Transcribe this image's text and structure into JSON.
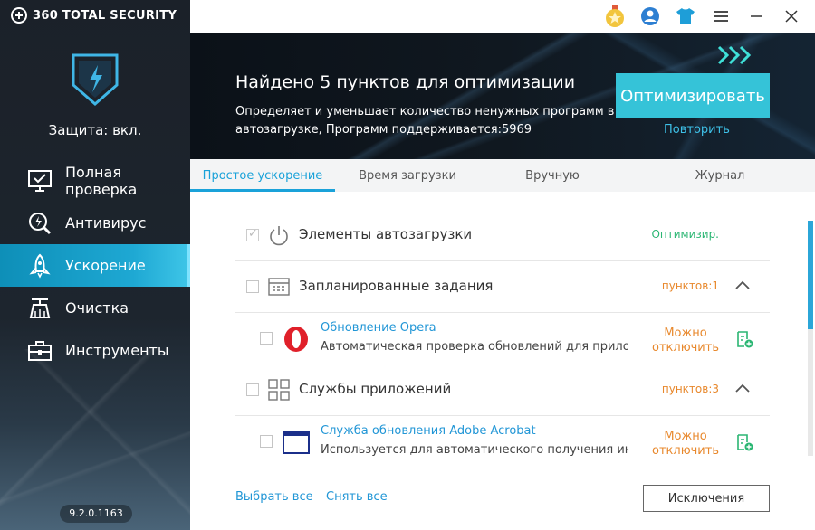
{
  "app": {
    "brand": "360 TOTAL SECURITY",
    "version": "9.2.0.1163"
  },
  "sidebar": {
    "protection": "Защита: вкл.",
    "items": [
      {
        "label": "Полная проверка",
        "icon": "monitor-check-icon",
        "active": false
      },
      {
        "label": "Антивирус",
        "icon": "magnifier-bolt-icon",
        "active": false
      },
      {
        "label": "Ускорение",
        "icon": "rocket-icon",
        "active": true
      },
      {
        "label": "Очистка",
        "icon": "broom-icon",
        "active": false
      },
      {
        "label": "Инструменты",
        "icon": "toolbox-icon",
        "active": false
      }
    ]
  },
  "topbar": {
    "icons": [
      "medal-icon",
      "user-icon",
      "shirt-icon",
      "menu-icon",
      "minimize-icon",
      "close-icon"
    ]
  },
  "header": {
    "title": "Найдено 5 пунктов для оптимизации",
    "description": "Определяет и уменьшает количество ненужных программ в автозагрузке, Программ поддерживается:5969",
    "optimize_button": "Оптимизировать",
    "repeat_link": "Повторить"
  },
  "tabs": [
    {
      "label": "Простое ускорение",
      "active": true
    },
    {
      "label": "Время загрузки",
      "active": false
    },
    {
      "label": "Вручную",
      "active": false
    },
    {
      "label": "Журнал",
      "active": false
    }
  ],
  "groups": {
    "startup": {
      "label": "Элементы автозагрузки",
      "status": "Оптимизир.",
      "status_color": "#2bb673"
    },
    "scheduled": {
      "label": "Запланированные задания",
      "status": "пунктов:1",
      "status_color": "#e8882c"
    },
    "services": {
      "label": "Службы приложений",
      "status": "пунктов:3",
      "status_color": "#e8882c"
    }
  },
  "items": {
    "opera": {
      "title": "Обновление Opera",
      "desc": "Автоматическая проверка обновлений для прило...",
      "status_line1": "Можно",
      "status_line2": "отключить"
    },
    "acrobat": {
      "title": "Служба обновления Adobe Acrobat",
      "desc": "Используется для автоматического получения ин...",
      "status_line1": "Можно",
      "status_line2": "отключить"
    }
  },
  "footer": {
    "select_all": "Выбрать все",
    "deselect_all": "Снять все",
    "exclusions": "Исключения"
  },
  "colors": {
    "accent": "#1aa2d9",
    "optimize_button": "#35c3d8",
    "orange": "#e8882c",
    "green": "#2bb673"
  }
}
